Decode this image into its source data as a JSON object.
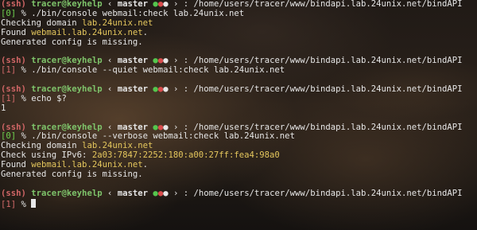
{
  "prompt": {
    "ssh": "(ssh)",
    "user": "tracer@keyhelp",
    "sep1": "‹",
    "branch": "master",
    "sep2": "› : /home/users/tracer/www/bindapi.lab.24unix.net/bindAPI"
  },
  "blocks": [
    {
      "code": "[0]",
      "code_status": "ok",
      "command": "% ./bin/console webmail:check lab.24unix.net",
      "output": [
        {
          "prefix": "Checking domain ",
          "value": "lab.24unix.net",
          "suffix": ""
        },
        {
          "prefix": "Found ",
          "value": "webmail.lab.24unix.net",
          "suffix": "."
        },
        {
          "prefix": "Generated config is missing.",
          "value": "",
          "suffix": ""
        }
      ]
    },
    {
      "code": "[1]",
      "code_status": "err",
      "command": "% ./bin/console --quiet webmail:check lab.24unix.net",
      "output": []
    },
    {
      "code": "[1]",
      "code_status": "err",
      "command": "% echo $?",
      "output": [
        {
          "prefix": "1",
          "value": "",
          "suffix": ""
        }
      ]
    },
    {
      "code": "[0]",
      "code_status": "ok",
      "command": "% ./bin/console --verbose webmail:check lab.24unix.net",
      "output": [
        {
          "prefix": "Checking domain ",
          "value": "lab.24unix.net",
          "suffix": ""
        },
        {
          "prefix": "Check using IPv6: ",
          "value": "2a03:7847:2252:180:a00:27ff:fea4:98a0",
          "suffix": ""
        },
        {
          "prefix": "Found ",
          "value": "webmail.lab.24unix.net",
          "suffix": "."
        },
        {
          "prefix": "Generated config is missing.",
          "value": "",
          "suffix": ""
        }
      ]
    }
  ],
  "final": {
    "code": "[1]",
    "code_status": "err",
    "command": "%"
  },
  "colors": {
    "ok": "#6fd24f",
    "err": "#d36a6a",
    "highlight": "#e5c75d"
  },
  "icons": {
    "status_dots": "git-status-dots-icon",
    "cursor": "cursor-block-icon"
  }
}
